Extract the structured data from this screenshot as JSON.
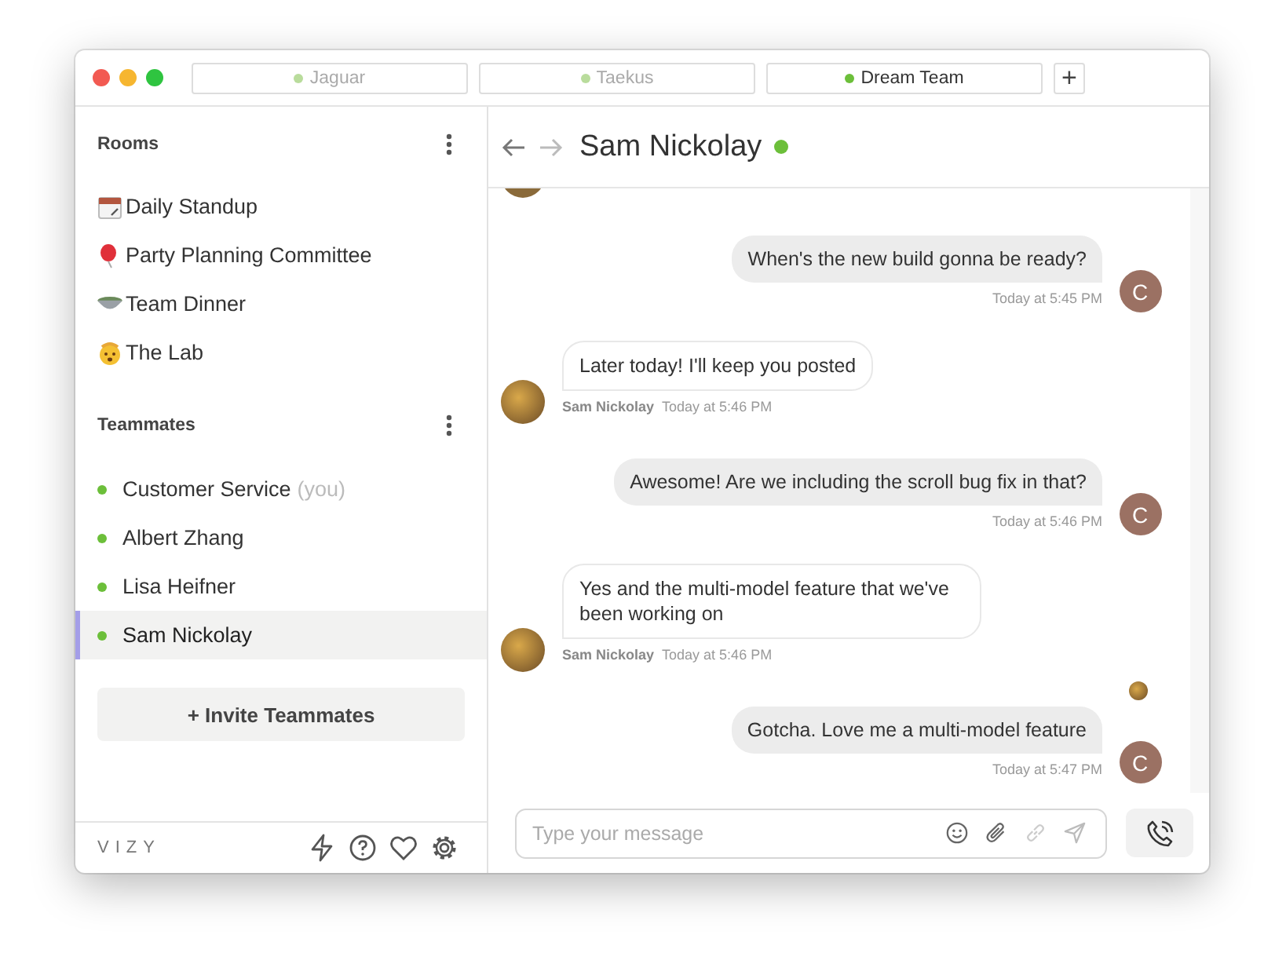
{
  "tabs": [
    {
      "label": "Jaguar",
      "selected": false
    },
    {
      "label": "Taekus",
      "selected": false
    },
    {
      "label": "Dream Team",
      "selected": true
    }
  ],
  "new_tab_button": "+",
  "sidebar": {
    "rooms_title": "Rooms",
    "rooms": [
      {
        "name": "Daily Standup",
        "kind": "calendar"
      },
      {
        "name": "Party Planning Committee",
        "kind": "balloon"
      },
      {
        "name": "Team Dinner",
        "kind": "bowl"
      },
      {
        "name": "The Lab",
        "kind": "face"
      }
    ],
    "teammates_title": "Teammates",
    "teammates": [
      {
        "name": "Customer Service",
        "suffix": "(you)",
        "online": true,
        "selected": false
      },
      {
        "name": "Albert Zhang",
        "online": true,
        "selected": false
      },
      {
        "name": "Lisa Heifner",
        "online": true,
        "selected": false
      },
      {
        "name": "Sam Nickolay",
        "online": true,
        "selected": true
      }
    ],
    "invite_button": "+ Invite Teammates",
    "brand": "VIZY"
  },
  "chat": {
    "title": "Sam Nickolay",
    "online": true,
    "messages": [
      {
        "kind": "outgoing",
        "text": "When's the new build gonna be ready?",
        "time": "Today at 5:45 PM",
        "avatar": "C",
        "read_receipt": false
      },
      {
        "kind": "incoming",
        "text": "Later today! I'll keep you posted",
        "sender": "Sam Nickolay",
        "time": "Today at 5:46 PM"
      },
      {
        "kind": "outgoing",
        "text": "Awesome! Are we including the scroll bug fix in that?",
        "time": "Today at 5:46 PM",
        "avatar": "C",
        "read_receipt": false
      },
      {
        "kind": "incoming",
        "text": "Yes and the multi-model feature that we've been working on",
        "sender": "Sam Nickolay",
        "time": "Today at 5:46 PM"
      },
      {
        "kind": "outgoing",
        "text": "Gotcha. Love me a multi-model feature",
        "time": "Today at 5:47 PM",
        "avatar": "C",
        "read_receipt": true
      }
    ],
    "composer": {
      "placeholder": "Type your message"
    }
  }
}
